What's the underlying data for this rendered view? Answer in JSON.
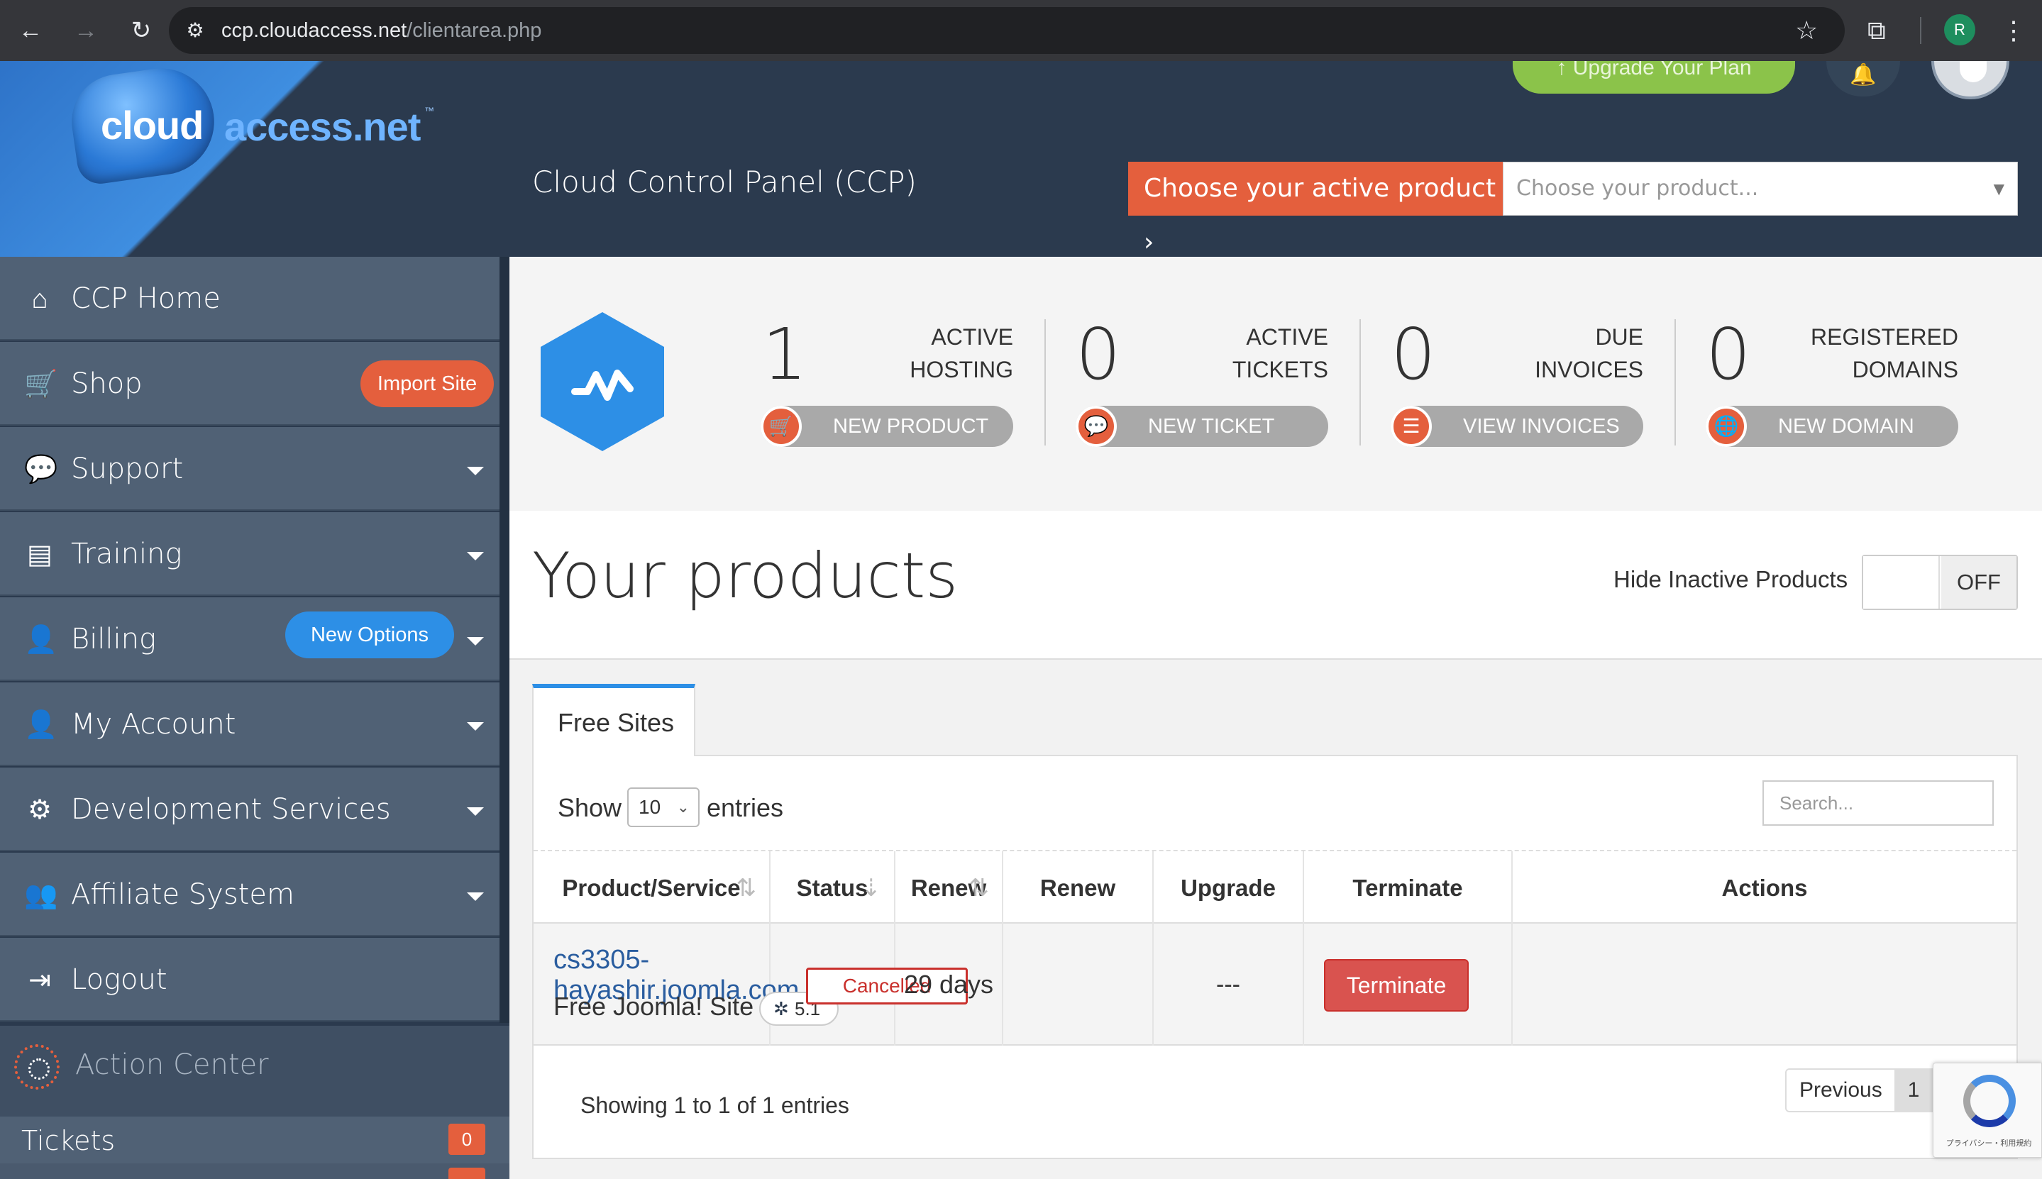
{
  "browser": {
    "url_host": "ccp.cloudaccess.net",
    "url_path": "/clientarea.php",
    "profile_initial": "R"
  },
  "brand": {
    "logo_part1": "cloud",
    "logo_part2": "access.net",
    "logo_tm": "™"
  },
  "header": {
    "upgrade_label": "↑ Upgrade Your Plan",
    "panel_title": "Cloud Control Panel (CCP)",
    "choose_button": "Choose your active product",
    "choose_placeholder": "Choose your product..."
  },
  "sidebar": {
    "items": [
      {
        "label": "CCP Home",
        "icon": "home-icon"
      },
      {
        "label": "Shop",
        "icon": "cart-icon"
      },
      {
        "label": "Support",
        "icon": "chat-icon"
      },
      {
        "label": "Training",
        "icon": "book-icon"
      },
      {
        "label": "Billing",
        "icon": "user-icon"
      },
      {
        "label": "My Account",
        "icon": "user-icon"
      },
      {
        "label": "Development Services",
        "icon": "gears-icon"
      },
      {
        "label": "Affiliate System",
        "icon": "users-icon"
      },
      {
        "label": "Logout",
        "icon": "logout-icon"
      }
    ],
    "import_site": "Import Site",
    "new_options": "New Options",
    "action_center": "Action Center",
    "tickets_label": "Tickets",
    "tickets_count": "0"
  },
  "stats": [
    {
      "value": "1",
      "line1": "ACTIVE",
      "line2": "HOSTING",
      "button": "NEW PRODUCT",
      "icon": "cart-icon"
    },
    {
      "value": "0",
      "line1": "ACTIVE",
      "line2": "TICKETS",
      "button": "NEW TICKET",
      "icon": "chat-icon"
    },
    {
      "value": "0",
      "line1": "DUE",
      "line2": "INVOICES",
      "button": "VIEW INVOICES",
      "icon": "list-icon"
    },
    {
      "value": "0",
      "line1": "REGISTERED",
      "line2": "DOMAINS",
      "button": "NEW DOMAIN",
      "icon": "globe-icon"
    }
  ],
  "products": {
    "title": "Your products",
    "hide_inactive_label": "Hide Inactive Products",
    "toggle_state": "OFF",
    "tab_label": "Free Sites",
    "show_label": "Show",
    "entries_value": "10",
    "entries_label": "entries",
    "search_placeholder": "Search...",
    "columns": [
      "Product/Service",
      "Status",
      "Renew By",
      "Renew",
      "Upgrade",
      "Terminate",
      "Actions"
    ],
    "rows": [
      {
        "domain": "cs3305-hayashir.joomla.com",
        "type": "Free Joomla! Site",
        "version": "5.1",
        "status": "Cancelled",
        "renew_by": "29 days",
        "renew": "",
        "upgrade": "---",
        "terminate_label": "Terminate",
        "actions": ""
      }
    ],
    "showing": "Showing 1 to 1 of 1 entries",
    "prev_label": "Previous",
    "page": "1"
  },
  "recaptcha": {
    "text": "プライバシー・利用規約"
  },
  "colors": {
    "accent_orange": "#e45f3d",
    "accent_blue": "#2d8fe6",
    "sidebar_bg": "#506175",
    "header_bg": "#2b3a4e",
    "danger": "#d9534f",
    "upgrade_green": "#8bc34a"
  }
}
